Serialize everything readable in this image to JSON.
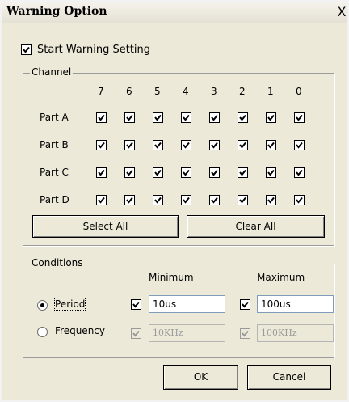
{
  "window": {
    "title": "Warning Option",
    "close_glyph": "X"
  },
  "start_warning": {
    "label": "Start Warning Setting",
    "checked": true
  },
  "channel": {
    "legend": "Channel",
    "columns": [
      "7",
      "6",
      "5",
      "4",
      "3",
      "2",
      "1",
      "0"
    ],
    "rows": [
      {
        "label": "Part A",
        "checked": [
          true,
          true,
          true,
          true,
          true,
          true,
          true,
          true
        ]
      },
      {
        "label": "Part B",
        "checked": [
          true,
          true,
          true,
          true,
          true,
          true,
          true,
          true
        ]
      },
      {
        "label": "Part C",
        "checked": [
          true,
          true,
          true,
          true,
          true,
          true,
          true,
          true
        ]
      },
      {
        "label": "Part D",
        "checked": [
          true,
          true,
          true,
          true,
          true,
          true,
          true,
          true
        ]
      }
    ],
    "select_all_label": "Select All",
    "clear_all_label": "Clear All"
  },
  "conditions": {
    "legend": "Conditions",
    "minimum_label": "Minimum",
    "maximum_label": "Maximum",
    "period": {
      "label": "Period",
      "selected": true,
      "min_checked": true,
      "min_value": "10us",
      "max_checked": true,
      "max_value": "100us"
    },
    "frequency": {
      "label": "Frequency",
      "selected": false,
      "min_checked": true,
      "min_value": "10KHz",
      "max_checked": true,
      "max_value": "100KHz"
    }
  },
  "buttons": {
    "ok_label": "OK",
    "cancel_label": "Cancel"
  }
}
